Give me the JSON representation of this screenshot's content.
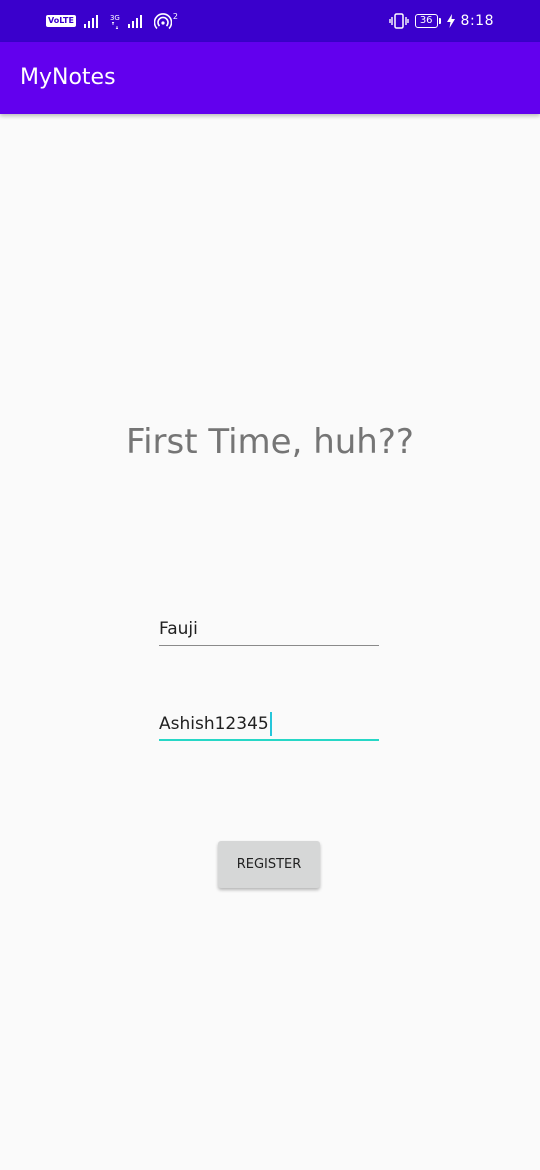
{
  "status_bar": {
    "volte_label": "VoLTE",
    "network_label": "3G",
    "hotspot_label": "2",
    "battery_level": "36",
    "time": "8:18"
  },
  "app_bar": {
    "title": "MyNotes"
  },
  "main": {
    "heading": "First Time, huh??",
    "name_field": {
      "value": "Fauji"
    },
    "password_field": {
      "value": "Ashish12345"
    },
    "register_button_label": "REGISTER"
  },
  "colors": {
    "status_bar": "#3a00cc",
    "app_bar": "#6200ee",
    "background": "#fafafa",
    "accent": "#26d7c6",
    "button": "#d6d7d7"
  }
}
